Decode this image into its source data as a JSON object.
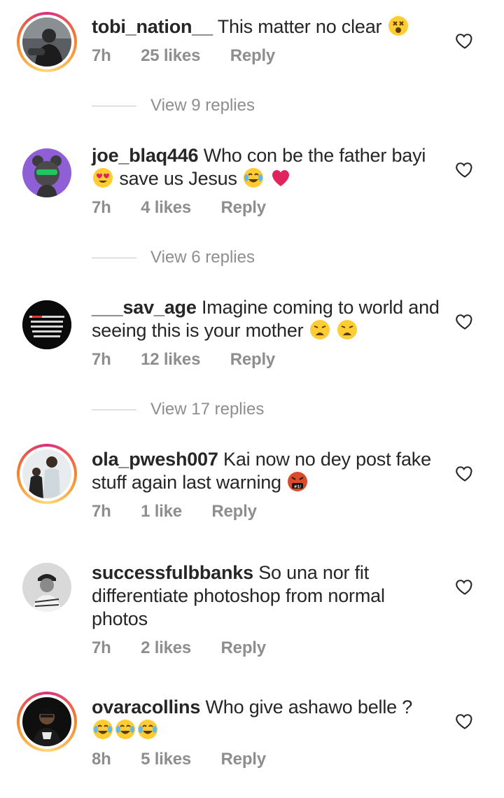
{
  "comments": [
    {
      "username": "tobi_nation__",
      "text": "This matter no clear",
      "emojis": [
        "dizzy-face-emoji"
      ],
      "time": "7h",
      "likes": "25 likes",
      "reply": "Reply",
      "has_story_ring": true,
      "view_replies": "View 9 replies"
    },
    {
      "username": "joe_blaq446",
      "text": "Who con be the father bayi",
      "text2": "save us Jesus",
      "emojis_before_text2": [
        "heart-eyes-emoji"
      ],
      "emojis": [
        "laughing-tears-emoji",
        "red-heart-emoji"
      ],
      "time": "7h",
      "likes": "4 likes",
      "reply": "Reply",
      "has_story_ring": false,
      "view_replies": "View 6 replies"
    },
    {
      "username": "___sav_age",
      "text": "Imagine coming to world and seeing this is your mother",
      "emojis": [
        "weary-face-emoji",
        "weary-face-emoji"
      ],
      "time": "7h",
      "likes": "12 likes",
      "reply": "Reply",
      "has_story_ring": false,
      "avatar_text": "Sometimes you have to thank God for how your day ends such an everyday. It could have been worse...",
      "view_replies": "View 17 replies"
    },
    {
      "username": "ola_pwesh007",
      "text": "Kai now no dey post fake stuff again last warning",
      "emojis": [
        "cursing-face-emoji"
      ],
      "time": "7h",
      "likes": "1 like",
      "reply": "Reply",
      "has_story_ring": true
    },
    {
      "username": "successfulbbanks",
      "text": "So una nor fit differentiate photoshop from normal photos",
      "emojis": [],
      "time": "7h",
      "likes": "2 likes",
      "reply": "Reply",
      "has_story_ring": false
    },
    {
      "username": "ovaracollins",
      "text": "Who give ashawo belle ?",
      "emojis": [
        "laughing-tears-emoji",
        "laughing-tears-emoji",
        "laughing-tears-emoji"
      ],
      "time": "8h",
      "likes": "5 likes",
      "reply": "Reply",
      "has_story_ring": true
    }
  ],
  "colors": {
    "text": "#262626",
    "muted": "#8e8e8e",
    "ring_start": "#d92e7f",
    "ring_end": "#f58529"
  },
  "icons": {
    "like": "heart-outline-icon"
  }
}
